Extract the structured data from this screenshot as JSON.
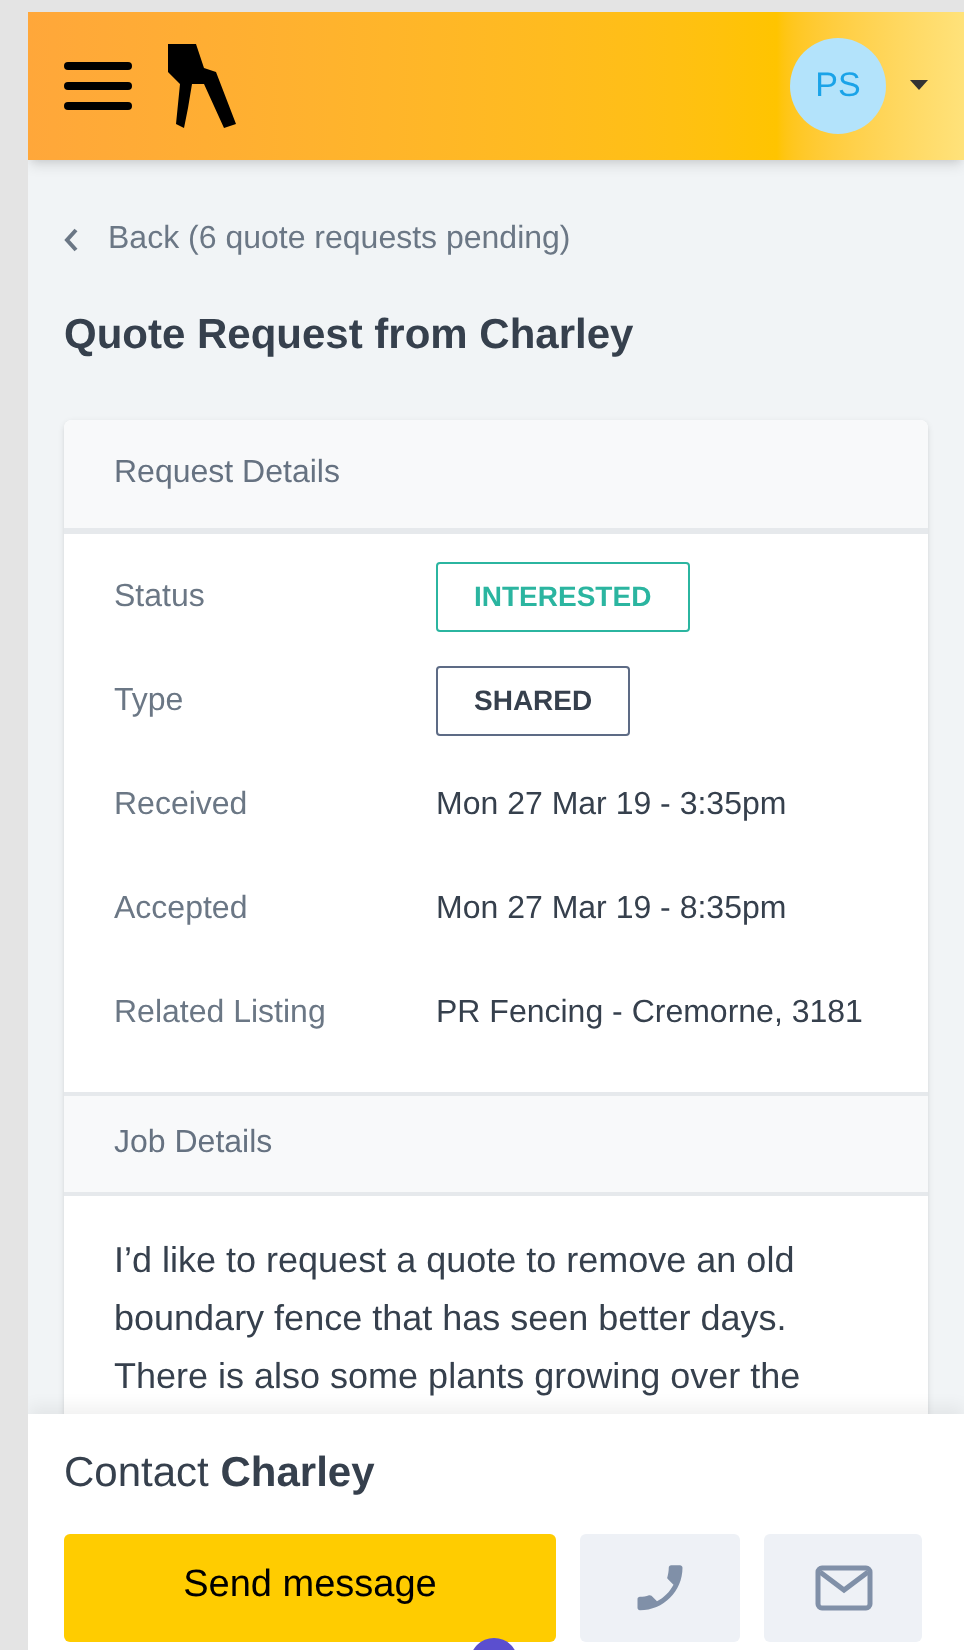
{
  "header": {
    "avatar": "PS"
  },
  "back_link": "Back (6 quote requests pending)",
  "title": "Quote Request from Charley",
  "request_details": {
    "heading": "Request Details",
    "rows": [
      {
        "label": "Status",
        "value": "INTERESTED",
        "kind": "badge",
        "color": "#2bb5a0"
      },
      {
        "label": "Type",
        "value": "SHARED",
        "kind": "badge",
        "color": "#5d6b85"
      },
      {
        "label": "Received",
        "value": "Mon 27 Mar 19 - 3:35pm",
        "kind": "text"
      },
      {
        "label": "Accepted",
        "value": "Mon 27 Mar 19 - 8:35pm",
        "kind": "text"
      },
      {
        "label": "Related Listing",
        "value": "PR Fencing - Cremorne, 3181",
        "kind": "text"
      }
    ]
  },
  "job_details": {
    "heading": "Job Details",
    "text": "I’d like to request a quote to remove an old boundary fence that has seen better days. There is also some plants growing over the"
  },
  "contact": {
    "title": "Contact **Charley**",
    "send_button": "Send message"
  }
}
